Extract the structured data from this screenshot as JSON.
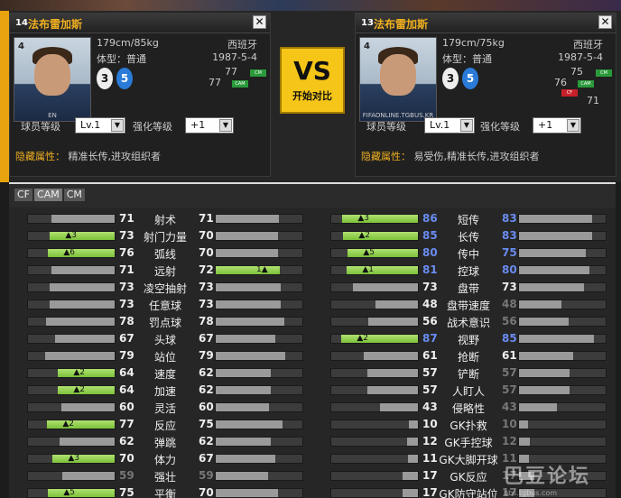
{
  "left_player": {
    "season": "14",
    "name": "法布雷加斯",
    "photo_number": "4",
    "photo_caption": "EN",
    "height_weight": "179cm/85kg",
    "nationality": "西班牙",
    "body_type": "体型：普通",
    "birthdate": "1987-5-4",
    "left_foot": "3",
    "right_foot": "5",
    "rating_a": "77",
    "rating_b": "77",
    "pos_badges": [
      "CM",
      "CAM"
    ],
    "level_label": "球员等级",
    "level_value": "Lv.1",
    "enhance_label": "强化等级",
    "enhance_value": "+1",
    "hidden_label": "隐藏属性：",
    "hidden_value": "精准长传,进攻组织者"
  },
  "right_player": {
    "season": "13",
    "name": "法布雷加斯",
    "photo_number": "4",
    "photo_caption": "FIFAONLINE.TGBUS.KR",
    "height_weight": "179cm/75kg",
    "nationality": "西班牙",
    "body_type": "体型：普通",
    "birthdate": "1987-5-4",
    "left_foot": "3",
    "right_foot": "5",
    "rating_a": "75",
    "rating_b": "76",
    "rating_c": "71",
    "pos_badges": [
      "CM",
      "CAM",
      "CF"
    ],
    "level_label": "球员等级",
    "level_value": "Lv.1",
    "enhance_label": "强化等级",
    "enhance_value": "+1",
    "hidden_label": "隐藏属性：",
    "hidden_value": "易受伤,精准长传,进攻组织者"
  },
  "vs": {
    "big": "VS",
    "small": "开始对比"
  },
  "close_symbol": "✕",
  "tabs": [
    "CF",
    "CAM",
    "CM"
  ],
  "colors": {
    "accent": "#f0b020",
    "upgrade_green": "#7cc23a",
    "highlight_blue": "#6a8cf0"
  },
  "stats_left": [
    {
      "label": "射术",
      "l": 71,
      "r": 71,
      "lup": "",
      "rup": ""
    },
    {
      "label": "射门力量",
      "l": 73,
      "r": 70,
      "lup": "▲3",
      "rup": ""
    },
    {
      "label": "弧线",
      "l": 76,
      "r": 70,
      "lup": "▲6",
      "rup": ""
    },
    {
      "label": "远射",
      "l": 71,
      "r": 72,
      "lup": "",
      "rup": "1▲"
    },
    {
      "label": "凌空抽射",
      "l": 73,
      "r": 73,
      "lup": "",
      "rup": ""
    },
    {
      "label": "任意球",
      "l": 73,
      "r": 73,
      "lup": "",
      "rup": ""
    },
    {
      "label": "罚点球",
      "l": 78,
      "r": 78,
      "lup": "",
      "rup": ""
    },
    {
      "label": "头球",
      "l": 67,
      "r": 67,
      "lup": "",
      "rup": ""
    },
    {
      "label": "站位",
      "l": 79,
      "r": 79,
      "lup": "",
      "rup": ""
    },
    {
      "label": "速度",
      "l": 64,
      "r": 62,
      "lup": "▲2",
      "rup": ""
    },
    {
      "label": "加速",
      "l": 64,
      "r": 62,
      "lup": "▲2",
      "rup": ""
    },
    {
      "label": "灵活",
      "l": 60,
      "r": 60,
      "lup": "",
      "rup": ""
    },
    {
      "label": "反应",
      "l": 77,
      "r": 75,
      "lup": "▲2",
      "rup": ""
    },
    {
      "label": "弹跳",
      "l": 62,
      "r": 62,
      "lup": "",
      "rup": ""
    },
    {
      "label": "体力",
      "l": 70,
      "r": 67,
      "lup": "▲3",
      "rup": ""
    },
    {
      "label": "强壮",
      "l": 59,
      "r": 59,
      "lup": "",
      "rup": ""
    },
    {
      "label": "平衡",
      "l": 75,
      "r": 70,
      "lup": "▲5",
      "rup": ""
    }
  ],
  "stats_right": [
    {
      "label": "短传",
      "l": 86,
      "r": 83,
      "lup": "▲3",
      "rup": ""
    },
    {
      "label": "长传",
      "l": 85,
      "r": 83,
      "lup": "▲2",
      "rup": ""
    },
    {
      "label": "传中",
      "l": 80,
      "r": 75,
      "lup": "▲5",
      "rup": ""
    },
    {
      "label": "控球",
      "l": 81,
      "r": 80,
      "lup": "▲1",
      "rup": ""
    },
    {
      "label": "盘带",
      "l": 73,
      "r": 73,
      "lup": "",
      "rup": ""
    },
    {
      "label": "盘带速度",
      "l": 48,
      "r": 48,
      "lup": "",
      "rup": ""
    },
    {
      "label": "战术意识",
      "l": 56,
      "r": 56,
      "lup": "",
      "rup": ""
    },
    {
      "label": "视野",
      "l": 87,
      "r": 85,
      "lup": "▲2",
      "rup": ""
    },
    {
      "label": "抢断",
      "l": 61,
      "r": 61,
      "lup": "",
      "rup": ""
    },
    {
      "label": "铲断",
      "l": 57,
      "r": 57,
      "lup": "",
      "rup": ""
    },
    {
      "label": "人盯人",
      "l": 57,
      "r": 57,
      "lup": "",
      "rup": ""
    },
    {
      "label": "侵略性",
      "l": 43,
      "r": 43,
      "lup": "",
      "rup": ""
    },
    {
      "label": "GK扑救",
      "l": 10,
      "r": 10,
      "lup": "",
      "rup": ""
    },
    {
      "label": "GK手控球",
      "l": 12,
      "r": 12,
      "lup": "",
      "rup": ""
    },
    {
      "label": "GK大脚开球",
      "l": 11,
      "r": 11,
      "lup": "",
      "rup": ""
    },
    {
      "label": "GK反应",
      "l": 17,
      "r": 17,
      "lup": "",
      "rup": ""
    },
    {
      "label": "GK防守站位",
      "l": 17,
      "r": 17,
      "lup": "",
      "rup": ""
    }
  ],
  "watermark": {
    "big": "巴豆论坛",
    "small": "bbs.tgbus.com"
  }
}
